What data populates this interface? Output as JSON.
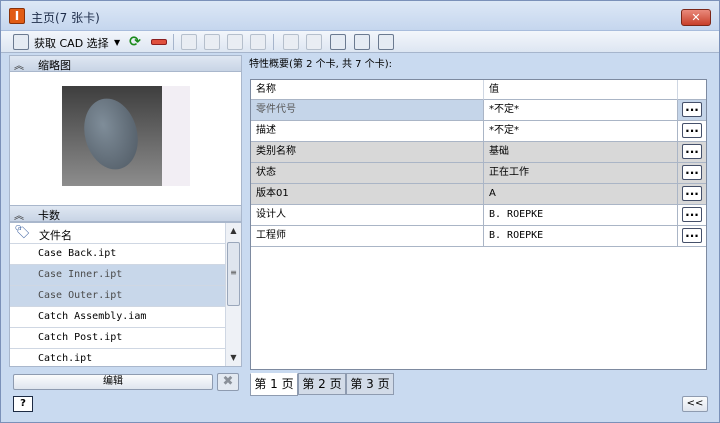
{
  "window": {
    "title": "主页(7 张卡)",
    "close": "✕",
    "app_icon": "I"
  },
  "toolbar": {
    "get_cad_label": "获取 CAD 选择",
    "dropdown_glyph": "▼",
    "refresh_glyph": "⟳"
  },
  "thumbnail": {
    "label": "缩略图"
  },
  "cards": {
    "label": "卡数",
    "column": "文件名",
    "files": [
      "Case Back.ipt",
      "Case Inner.ipt",
      "Case Outer.ipt",
      "Catch Assembly.iam",
      "Catch Post.ipt",
      "Catch.ipt"
    ]
  },
  "bottom": {
    "edit_label": "编辑",
    "clear_glyph": "✖",
    "help_glyph": "?",
    "collapse_glyph": "<<"
  },
  "properties": {
    "summary": "特性概要(第 2 个卡, 共 7 个卡):",
    "col_name": "名称",
    "col_value": "值",
    "more_glyph": "...",
    "rows": [
      {
        "name": "零件代号",
        "value": "*不定*"
      },
      {
        "name": "描述",
        "value": "*不定*"
      },
      {
        "name": "类别名称",
        "value": "基础"
      },
      {
        "name": "状态",
        "value": "正在工作"
      },
      {
        "name": "版本01",
        "value": "A"
      },
      {
        "name": "设计人",
        "value": "B. ROEPKE"
      },
      {
        "name": "工程师",
        "value": "B. ROEPKE"
      }
    ]
  },
  "tabs": [
    "第 1 页",
    "第 2 页",
    "第 3 页"
  ]
}
